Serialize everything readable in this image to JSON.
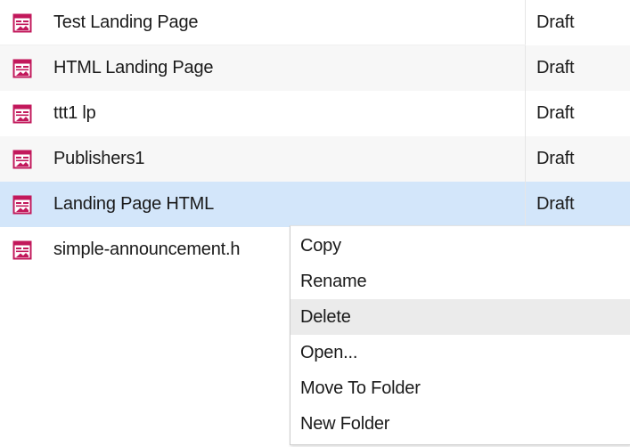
{
  "files": [
    {
      "name": "Test Landing Page",
      "status": "Draft",
      "icon": "landing-page-icon"
    },
    {
      "name": "HTML Landing Page",
      "status": "Draft",
      "icon": "landing-page-icon"
    },
    {
      "name": "ttt1 lp",
      "status": "Draft",
      "icon": "landing-page-icon"
    },
    {
      "name": "Publishers1",
      "status": "Draft",
      "icon": "landing-page-icon"
    },
    {
      "name": "Landing Page HTML",
      "status": "Draft",
      "icon": "landing-page-icon",
      "selected": true
    },
    {
      "name": "simple-announcement.h",
      "status": "",
      "icon": "landing-page-icon"
    }
  ],
  "context_menu": {
    "items": [
      {
        "label": "Copy"
      },
      {
        "label": "Rename"
      },
      {
        "label": "Delete",
        "hovered": true
      },
      {
        "label": "Open..."
      },
      {
        "label": "Move To Folder"
      },
      {
        "label": "New Folder"
      }
    ]
  },
  "colors": {
    "icon": "#c2185b",
    "selected_row": "#d3e6fa",
    "alt_row": "#f7f7f7",
    "menu_hover": "#ebebeb"
  }
}
